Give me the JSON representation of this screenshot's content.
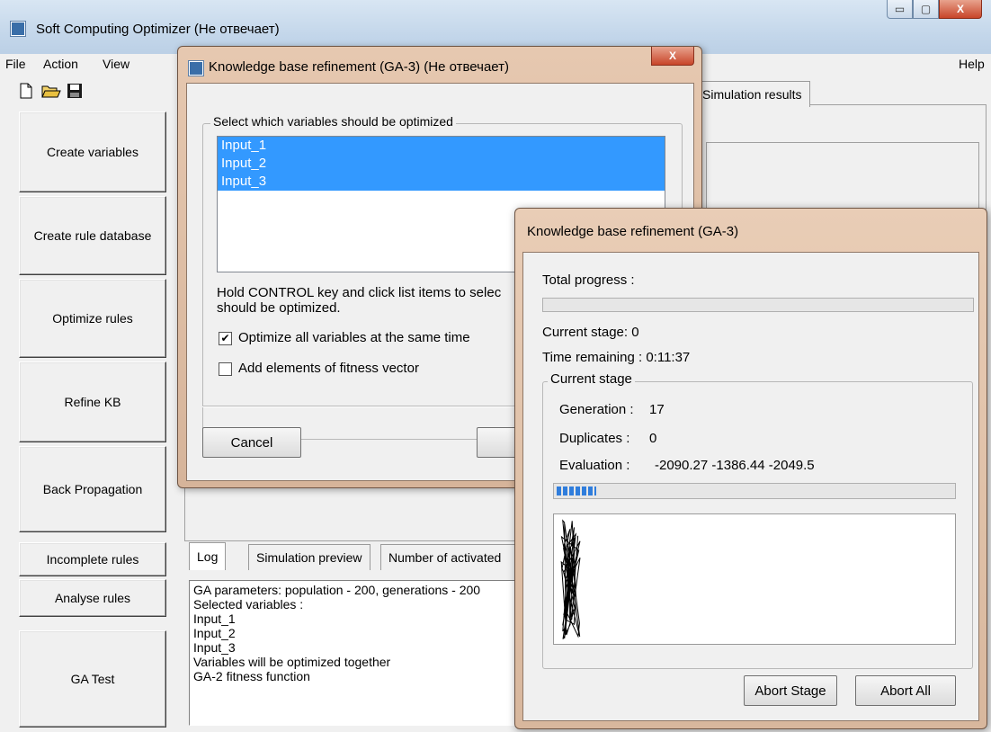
{
  "main": {
    "title": "Soft Computing Optimizer (Не отвечает)",
    "menu": [
      "File",
      "Action",
      "View"
    ],
    "help": "Help",
    "left_buttons": [
      "Create variables",
      "Create rule database",
      "Optimize rules",
      "Refine KB",
      "Back Propagation",
      "Incomplete rules",
      "Analyse rules",
      "GA Test"
    ],
    "top_tab": "Simulation results",
    "bottom_tabs": [
      "Log",
      "Simulation preview",
      "Number of activated"
    ],
    "log_lines": [
      "GA parameters: population - 200, generations - 200",
      "Selected variables :",
      "Input_1",
      "Input_2",
      "Input_3",
      "Variables will be optimized together",
      "GA-2 fitness function"
    ]
  },
  "dialog1": {
    "title": "Knowledge base refinement (GA-3) (Не отвечает)",
    "group_label": "Select which variables should be optimized",
    "variables": [
      "Input_1",
      "Input_2",
      "Input_3"
    ],
    "hint_line1": "Hold CONTROL key and click list items to selec",
    "hint_line2": "should be optimized.",
    "opt_all_label": "Optimize all variables at the same time",
    "opt_all_checked": true,
    "add_fitness_label": "Add elements of fitness vector",
    "add_fitness_checked": false,
    "cancel_label": "Cancel",
    "back_label": "<<"
  },
  "dialog2": {
    "title": "Knowledge base refinement (GA-3)",
    "total_progress_label": "Total progress :",
    "total_progress": 0,
    "current_stage_label": "Current stage:",
    "current_stage_value": "0",
    "time_remaining_label": "Time remaining :",
    "time_remaining_value": "0:11:37",
    "group_label": "Current stage",
    "generation_label": "Generation :",
    "generation_value": "17",
    "duplicates_label": "Duplicates :",
    "duplicates_value": "0",
    "evaluation_label": "Evaluation :",
    "evaluation_value": "-2090.27 -1386.44 -2049.5",
    "stage_progress": 0.1,
    "abort_stage_label": "Abort Stage",
    "abort_all_label": "Abort All"
  }
}
